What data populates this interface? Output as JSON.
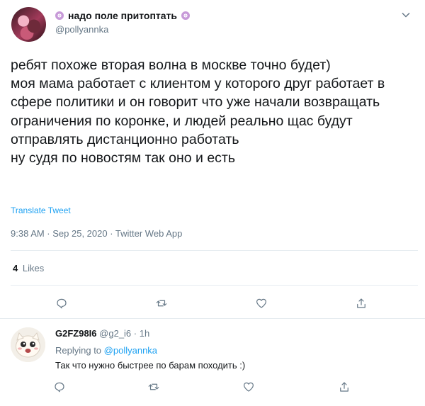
{
  "tweet": {
    "display_name": "надо поле притоптать",
    "handle": "@pollyannka",
    "text": "ребят похоже вторая волна в москве точно будет)\nмоя мама работает с клиентом у которого друг работает в сфере политики и он говорит что уже начали возвращать ограничения по коронке, и людей реально щас будут отправлять дистанционно работать\nну судя по новостям так оно и есть",
    "translate_label": "Translate Tweet",
    "timestamp": "9:38 AM · Sep 25, 2020 · Twitter Web App",
    "likes_count": "4",
    "likes_label": "Likes"
  },
  "reply": {
    "display_name": "G2FZ98I6",
    "handle_time": "@g2_i6 · 1h",
    "replying_prefix": "Replying to",
    "replying_handle": "@pollyannka",
    "text": "Так что нужно быстрее по барам походить :)"
  },
  "icons": {
    "reply": "comment-icon",
    "retweet": "retweet-icon",
    "like": "heart-icon",
    "share": "share-icon",
    "caret": "chevron-down-icon",
    "name_decoration": "swirl-icon"
  },
  "colors": {
    "link": "#1da1f2",
    "secondary_text": "#657786",
    "divider": "#e6ecf0"
  }
}
